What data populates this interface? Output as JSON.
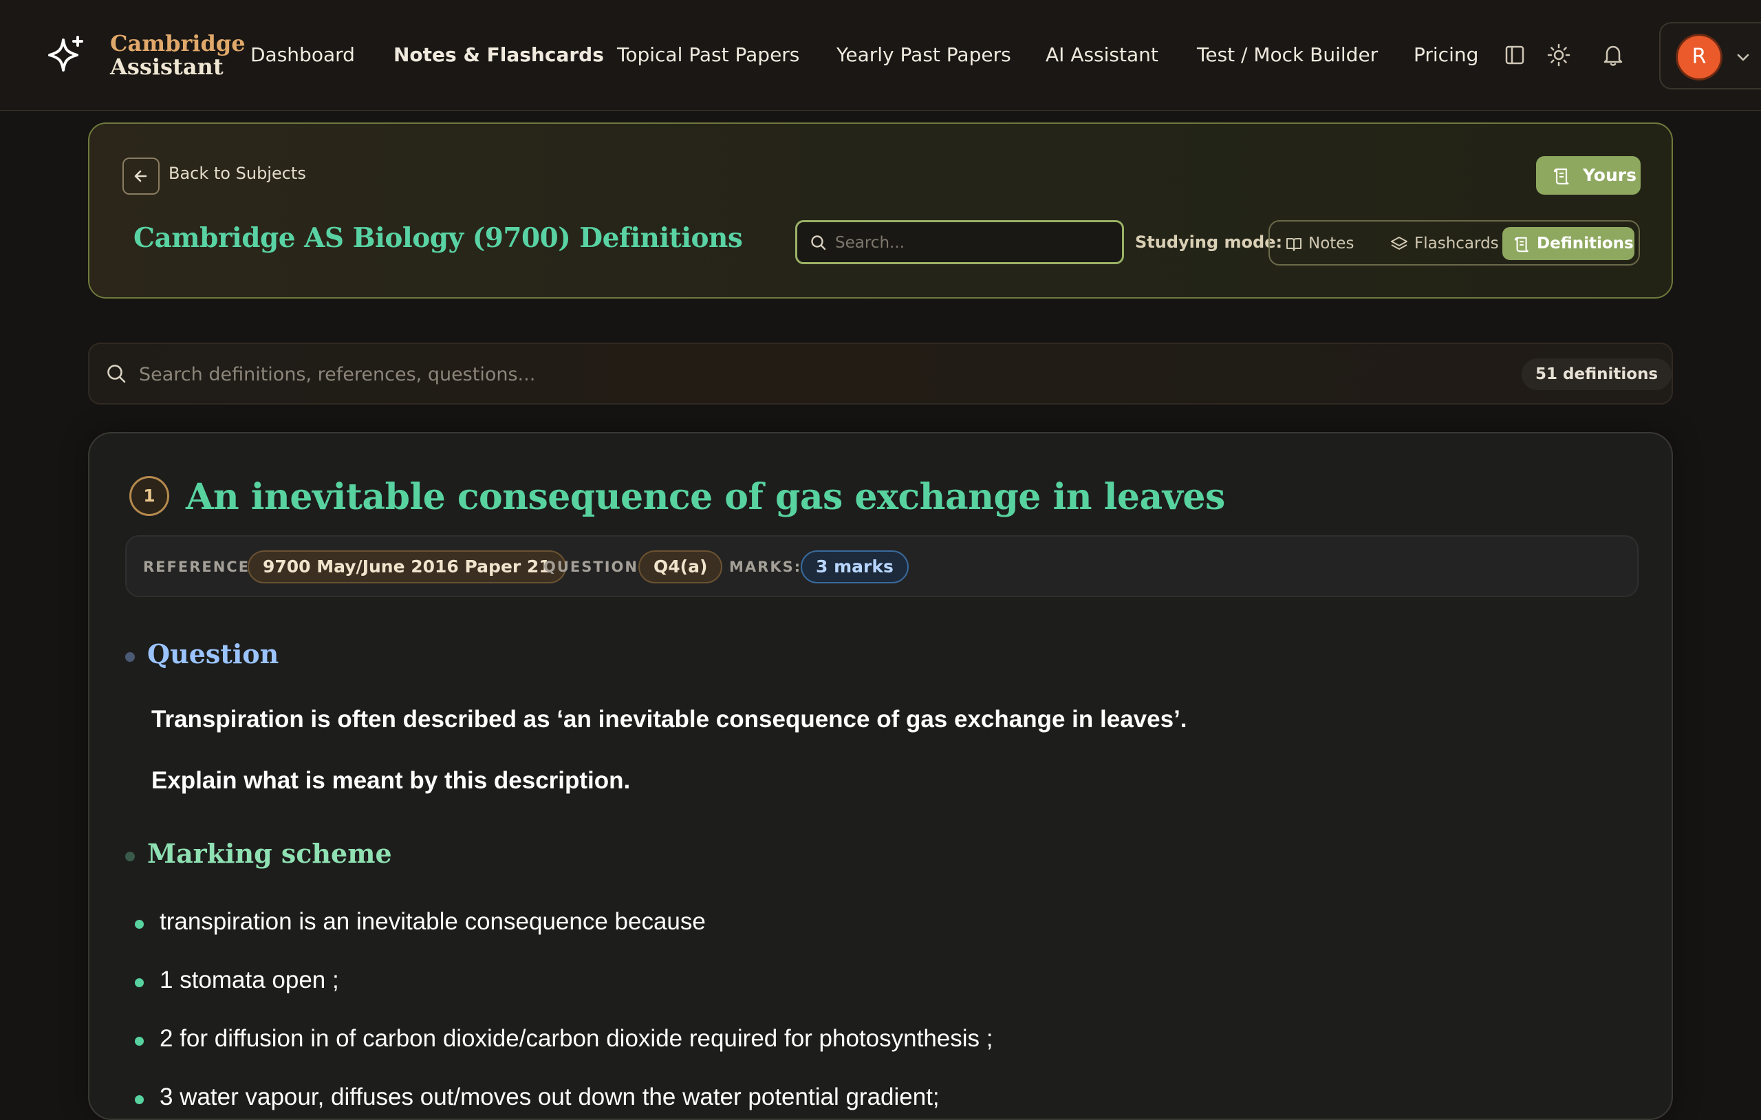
{
  "brand": {
    "line1": "Cambridge",
    "line2": "Assistant"
  },
  "nav": {
    "items": [
      {
        "label": "Dashboard"
      },
      {
        "label": "Notes & Flashcards"
      },
      {
        "label": "Topical Past Papers"
      },
      {
        "label": "Yearly Past Papers"
      },
      {
        "label": "AI Assistant"
      },
      {
        "label": "Test / Mock Builder"
      },
      {
        "label": "Pricing"
      }
    ]
  },
  "user": {
    "initial": "R"
  },
  "header": {
    "back_label": "Back to Subjects",
    "yours_label": "Yours",
    "title": "Cambridge AS Biology (9700) Definitions",
    "search_placeholder": "Search...",
    "mode_label": "Studying mode:",
    "modes": [
      {
        "label": "Notes"
      },
      {
        "label": "Flashcards"
      },
      {
        "label": "Definitions",
        "active": true
      }
    ]
  },
  "definitions_search": {
    "placeholder": "Search definitions, references, questions...",
    "count": "51 definitions"
  },
  "card": {
    "number": "1",
    "title": "An inevitable consequence of gas exchange in leaves",
    "meta": {
      "reference_label": "REFERENCE:",
      "reference": "9700 May/June 2016 Paper 21",
      "question_label": "QUESTION:",
      "question": "Q4(a)",
      "marks_label": "MARKS:",
      "marks": "3 marks"
    },
    "question_heading": "Question",
    "question_lines": [
      "Transpiration is often described as ‘an inevitable consequence of gas exchange in leaves’.",
      "Explain what is meant by this description."
    ],
    "marking_heading": "Marking scheme",
    "marking_items": [
      "transpiration is an inevitable consequence because",
      "1 stomata open ;",
      "2 for diffusion in of carbon dioxide/carbon dioxide required for photosynthesis ;",
      "3 water vapour, diffuses out/moves out down the water potential gradient;"
    ]
  },
  "colors": {
    "accent_green": "#8fa860",
    "title_teal": "#58d3a0",
    "brand_orange": "#e1a86b",
    "avatar": "#ea5a2b"
  }
}
